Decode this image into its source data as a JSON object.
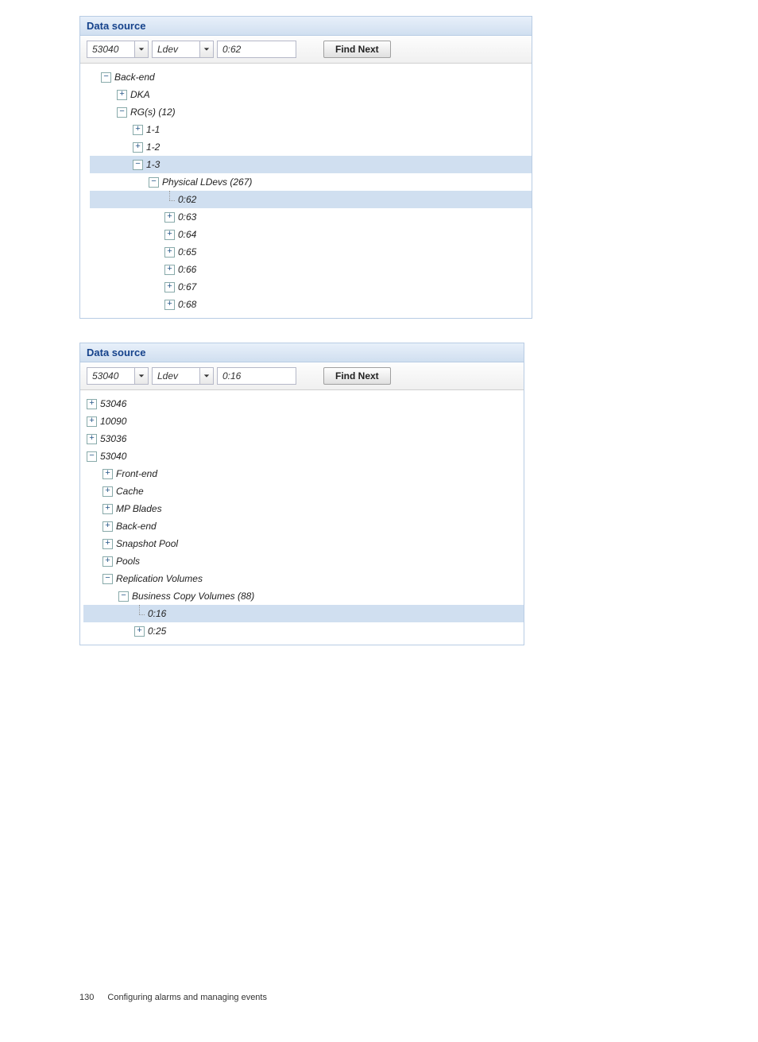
{
  "panel1": {
    "title": "Data source",
    "search": {
      "device": "53040",
      "type": "Ldev",
      "query": "0:62",
      "button": "Find Next"
    },
    "tree": [
      {
        "depth": 0,
        "expand": "minus",
        "label": "Back-end",
        "selected": false
      },
      {
        "depth": 1,
        "expand": "plus",
        "label": "DKA",
        "selected": false
      },
      {
        "depth": 1,
        "expand": "minus",
        "label": "RG(s) (12)",
        "selected": false
      },
      {
        "depth": 2,
        "expand": "plus",
        "label": "1-1",
        "selected": false
      },
      {
        "depth": 2,
        "expand": "plus",
        "label": "1-2",
        "selected": false
      },
      {
        "depth": 2,
        "expand": "minus",
        "label": "1-3",
        "selected": true
      },
      {
        "depth": 3,
        "expand": "minus",
        "label": "Physical LDevs (267)",
        "selected": false
      },
      {
        "depth": 4,
        "expand": "leaf",
        "label": "0:62",
        "selected": true
      },
      {
        "depth": 4,
        "expand": "plus",
        "label": "0:63",
        "selected": false
      },
      {
        "depth": 4,
        "expand": "plus",
        "label": "0:64",
        "selected": false
      },
      {
        "depth": 4,
        "expand": "plus",
        "label": "0:65",
        "selected": false
      },
      {
        "depth": 4,
        "expand": "plus",
        "label": "0:66",
        "selected": false
      },
      {
        "depth": 4,
        "expand": "plus",
        "label": "0:67",
        "selected": false
      },
      {
        "depth": 4,
        "expand": "plus",
        "label": "0:68",
        "selected": false
      }
    ]
  },
  "panel2": {
    "title": "Data source",
    "search": {
      "device": "53040",
      "type": "Ldev",
      "query": "0:16",
      "button": "Find Next"
    },
    "tree": [
      {
        "depth": 0,
        "expand": "plus",
        "label": "53046",
        "selected": false
      },
      {
        "depth": 0,
        "expand": "plus",
        "label": "10090",
        "selected": false
      },
      {
        "depth": 0,
        "expand": "plus",
        "label": "53036",
        "selected": false
      },
      {
        "depth": 0,
        "expand": "minus",
        "label": "53040",
        "selected": false
      },
      {
        "depth": 1,
        "expand": "plus",
        "label": "Front-end",
        "selected": false
      },
      {
        "depth": 1,
        "expand": "plus",
        "label": "Cache",
        "selected": false
      },
      {
        "depth": 1,
        "expand": "plus",
        "label": "MP Blades",
        "selected": false
      },
      {
        "depth": 1,
        "expand": "plus",
        "label": "Back-end",
        "selected": false
      },
      {
        "depth": 1,
        "expand": "plus",
        "label": "Snapshot Pool",
        "selected": false
      },
      {
        "depth": 1,
        "expand": "plus",
        "label": "Pools",
        "selected": false
      },
      {
        "depth": 1,
        "expand": "minus",
        "label": "Replication Volumes",
        "selected": false
      },
      {
        "depth": 2,
        "expand": "minus",
        "label": "Business Copy Volumes (88)",
        "selected": false
      },
      {
        "depth": 3,
        "expand": "leaf",
        "label": "0:16",
        "selected": true
      },
      {
        "depth": 3,
        "expand": "plus",
        "label": "0:25",
        "selected": false
      }
    ]
  },
  "footer": {
    "page": "130",
    "text": "Configuring alarms and managing events"
  }
}
